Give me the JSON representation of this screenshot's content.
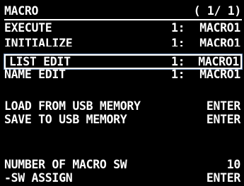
{
  "header": {
    "title": "MACRO",
    "page": "( 1/ 1)"
  },
  "menu": {
    "items": [
      {
        "label": "EXECUTE",
        "number": "1:",
        "value": "MACRO1"
      },
      {
        "label": "INITIALIZE",
        "number": "1:",
        "value": "MACRO1"
      },
      {
        "label": "LIST EDIT",
        "number": "1:",
        "value": "MACRO1"
      },
      {
        "label": "NAME EDIT",
        "number": "1:",
        "value": "MACRO1"
      },
      {
        "label": "LOAD FROM USB MEMORY",
        "value": "ENTER"
      },
      {
        "label": "SAVE TO USB MEMORY",
        "value": "ENTER"
      },
      {
        "label": "NUMBER OF MACRO SW",
        "value": "10"
      },
      {
        "label": "-SW ASSIGN",
        "value": "ENTER"
      }
    ],
    "selected": "LIST EDIT"
  },
  "colors": {
    "background": "#000000",
    "text": "#ffffff",
    "selection_glow": "#6f8fb8"
  }
}
